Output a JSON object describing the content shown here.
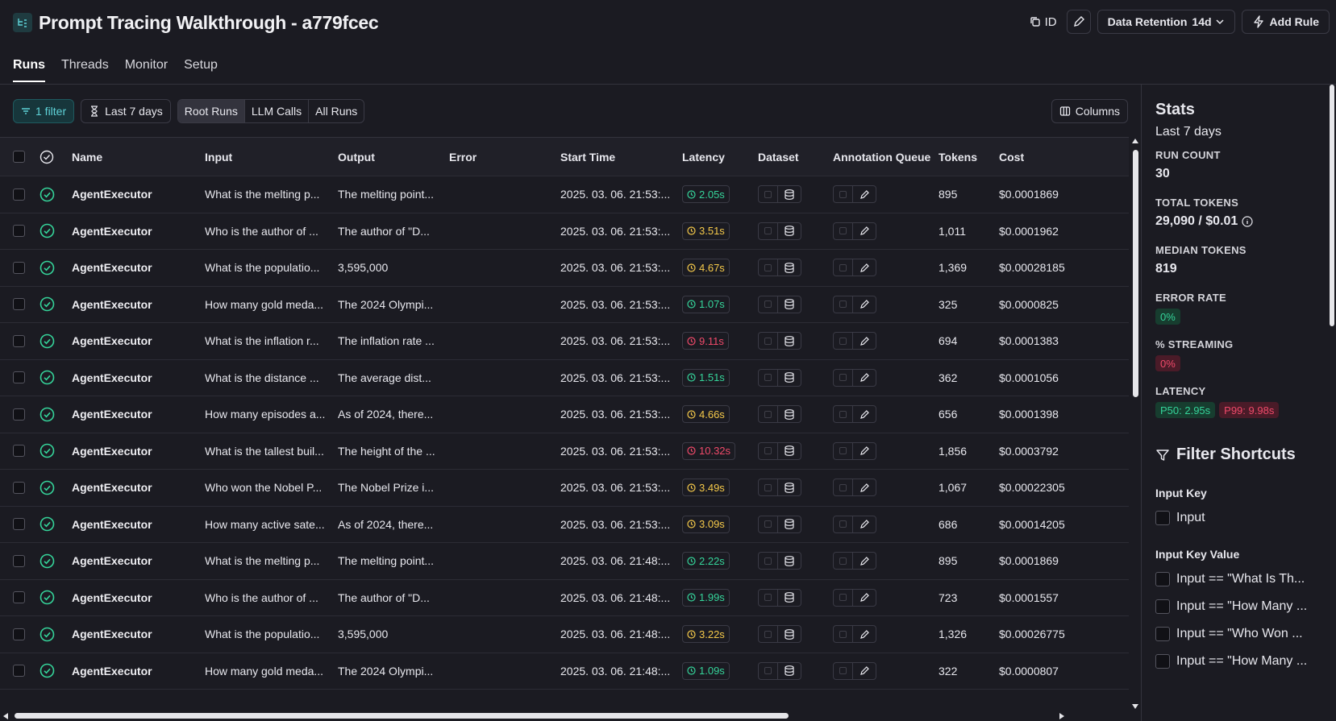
{
  "header": {
    "title": "Prompt Tracing Walkthrough - a779fcec",
    "id_label": "ID",
    "retention_label": "Data Retention",
    "retention_value": "14d",
    "add_rule_label": "Add Rule"
  },
  "tabs": [
    "Runs",
    "Threads",
    "Monitor",
    "Setup"
  ],
  "toolbar": {
    "filter_label": "1 filter",
    "time_label": "Last 7 days",
    "segments": [
      "Root Runs",
      "LLM Calls",
      "All Runs"
    ],
    "active_segment": "Root Runs",
    "columns_label": "Columns"
  },
  "columns": [
    "Name",
    "Input",
    "Output",
    "Error",
    "Start Time",
    "Latency",
    "Dataset",
    "Annotation Queue",
    "Tokens",
    "Cost"
  ],
  "rows": [
    {
      "name": "AgentExecutor",
      "input": "What is the melting p...",
      "output": "The melting point...",
      "start": "2025. 03. 06. 21:53:...",
      "latency": "2.05s",
      "lat_status": "green",
      "tokens": "895",
      "cost": "$0.0001869"
    },
    {
      "name": "AgentExecutor",
      "input": "Who is the author of ...",
      "output": "The author of \"D...",
      "start": "2025. 03. 06. 21:53:...",
      "latency": "3.51s",
      "lat_status": "yellow",
      "tokens": "1,011",
      "cost": "$0.0001962"
    },
    {
      "name": "AgentExecutor",
      "input": "What is the populatio...",
      "output": "3,595,000",
      "start": "2025. 03. 06. 21:53:...",
      "latency": "4.67s",
      "lat_status": "yellow",
      "tokens": "1,369",
      "cost": "$0.00028185"
    },
    {
      "name": "AgentExecutor",
      "input": "How many gold meda...",
      "output": "The 2024 Olympi...",
      "start": "2025. 03. 06. 21:53:...",
      "latency": "1.07s",
      "lat_status": "green",
      "tokens": "325",
      "cost": "$0.0000825"
    },
    {
      "name": "AgentExecutor",
      "input": "What is the inflation r...",
      "output": "The inflation rate ...",
      "start": "2025. 03. 06. 21:53:...",
      "latency": "9.11s",
      "lat_status": "red",
      "tokens": "694",
      "cost": "$0.0001383"
    },
    {
      "name": "AgentExecutor",
      "input": "What is the distance ...",
      "output": "The average dist...",
      "start": "2025. 03. 06. 21:53:...",
      "latency": "1.51s",
      "lat_status": "green",
      "tokens": "362",
      "cost": "$0.0001056"
    },
    {
      "name": "AgentExecutor",
      "input": "How many episodes a...",
      "output": "As of 2024, there...",
      "start": "2025. 03. 06. 21:53:...",
      "latency": "4.66s",
      "lat_status": "yellow",
      "tokens": "656",
      "cost": "$0.0001398"
    },
    {
      "name": "AgentExecutor",
      "input": "What is the tallest buil...",
      "output": "The height of the ...",
      "start": "2025. 03. 06. 21:53:...",
      "latency": "10.32s",
      "lat_status": "red",
      "tokens": "1,856",
      "cost": "$0.0003792"
    },
    {
      "name": "AgentExecutor",
      "input": "Who won the Nobel P...",
      "output": "The Nobel Prize i...",
      "start": "2025. 03. 06. 21:53:...",
      "latency": "3.49s",
      "lat_status": "yellow",
      "tokens": "1,067",
      "cost": "$0.00022305"
    },
    {
      "name": "AgentExecutor",
      "input": "How many active sate...",
      "output": "As of 2024, there...",
      "start": "2025. 03. 06. 21:53:...",
      "latency": "3.09s",
      "lat_status": "yellow",
      "tokens": "686",
      "cost": "$0.00014205"
    },
    {
      "name": "AgentExecutor",
      "input": "What is the melting p...",
      "output": "The melting point...",
      "start": "2025. 03. 06. 21:48:...",
      "latency": "2.22s",
      "lat_status": "green",
      "tokens": "895",
      "cost": "$0.0001869"
    },
    {
      "name": "AgentExecutor",
      "input": "Who is the author of ...",
      "output": "The author of \"D...",
      "start": "2025. 03. 06. 21:48:...",
      "latency": "1.99s",
      "lat_status": "green",
      "tokens": "723",
      "cost": "$0.0001557"
    },
    {
      "name": "AgentExecutor",
      "input": "What is the populatio...",
      "output": "3,595,000",
      "start": "2025. 03. 06. 21:48:...",
      "latency": "3.22s",
      "lat_status": "yellow",
      "tokens": "1,326",
      "cost": "$0.00026775"
    },
    {
      "name": "AgentExecutor",
      "input": "How many gold meda...",
      "output": "The 2024 Olympi...",
      "start": "2025. 03. 06. 21:48:...",
      "latency": "1.09s",
      "lat_status": "green",
      "tokens": "322",
      "cost": "$0.0000807"
    }
  ],
  "stats": {
    "title": "Stats",
    "subtitle": "Last 7 days",
    "run_count_label": "RUN COUNT",
    "run_count": "30",
    "total_tokens_label": "TOTAL TOKENS",
    "total_tokens": "29,090 / $0.01",
    "median_tokens_label": "MEDIAN TOKENS",
    "median_tokens": "819",
    "error_rate_label": "ERROR RATE",
    "error_rate": "0%",
    "streaming_label": "% STREAMING",
    "streaming": "0%",
    "latency_label": "LATENCY",
    "p50": "P50: 2.95s",
    "p99": "P99: 9.98s"
  },
  "filter_shortcuts": {
    "title": "Filter Shortcuts",
    "input_key_label": "Input Key",
    "input_key_items": [
      "Input"
    ],
    "input_key_value_label": "Input Key Value",
    "input_key_value_items": [
      "Input == \"What Is Th...",
      "Input == \"How Many ...",
      "Input == \"Who Won ...",
      "Input == \"How Many ..."
    ]
  },
  "colors": {
    "green": "#35d49a",
    "yellow": "#f5c94a",
    "red": "#f04a6a",
    "accent": "#5fd3d8"
  }
}
